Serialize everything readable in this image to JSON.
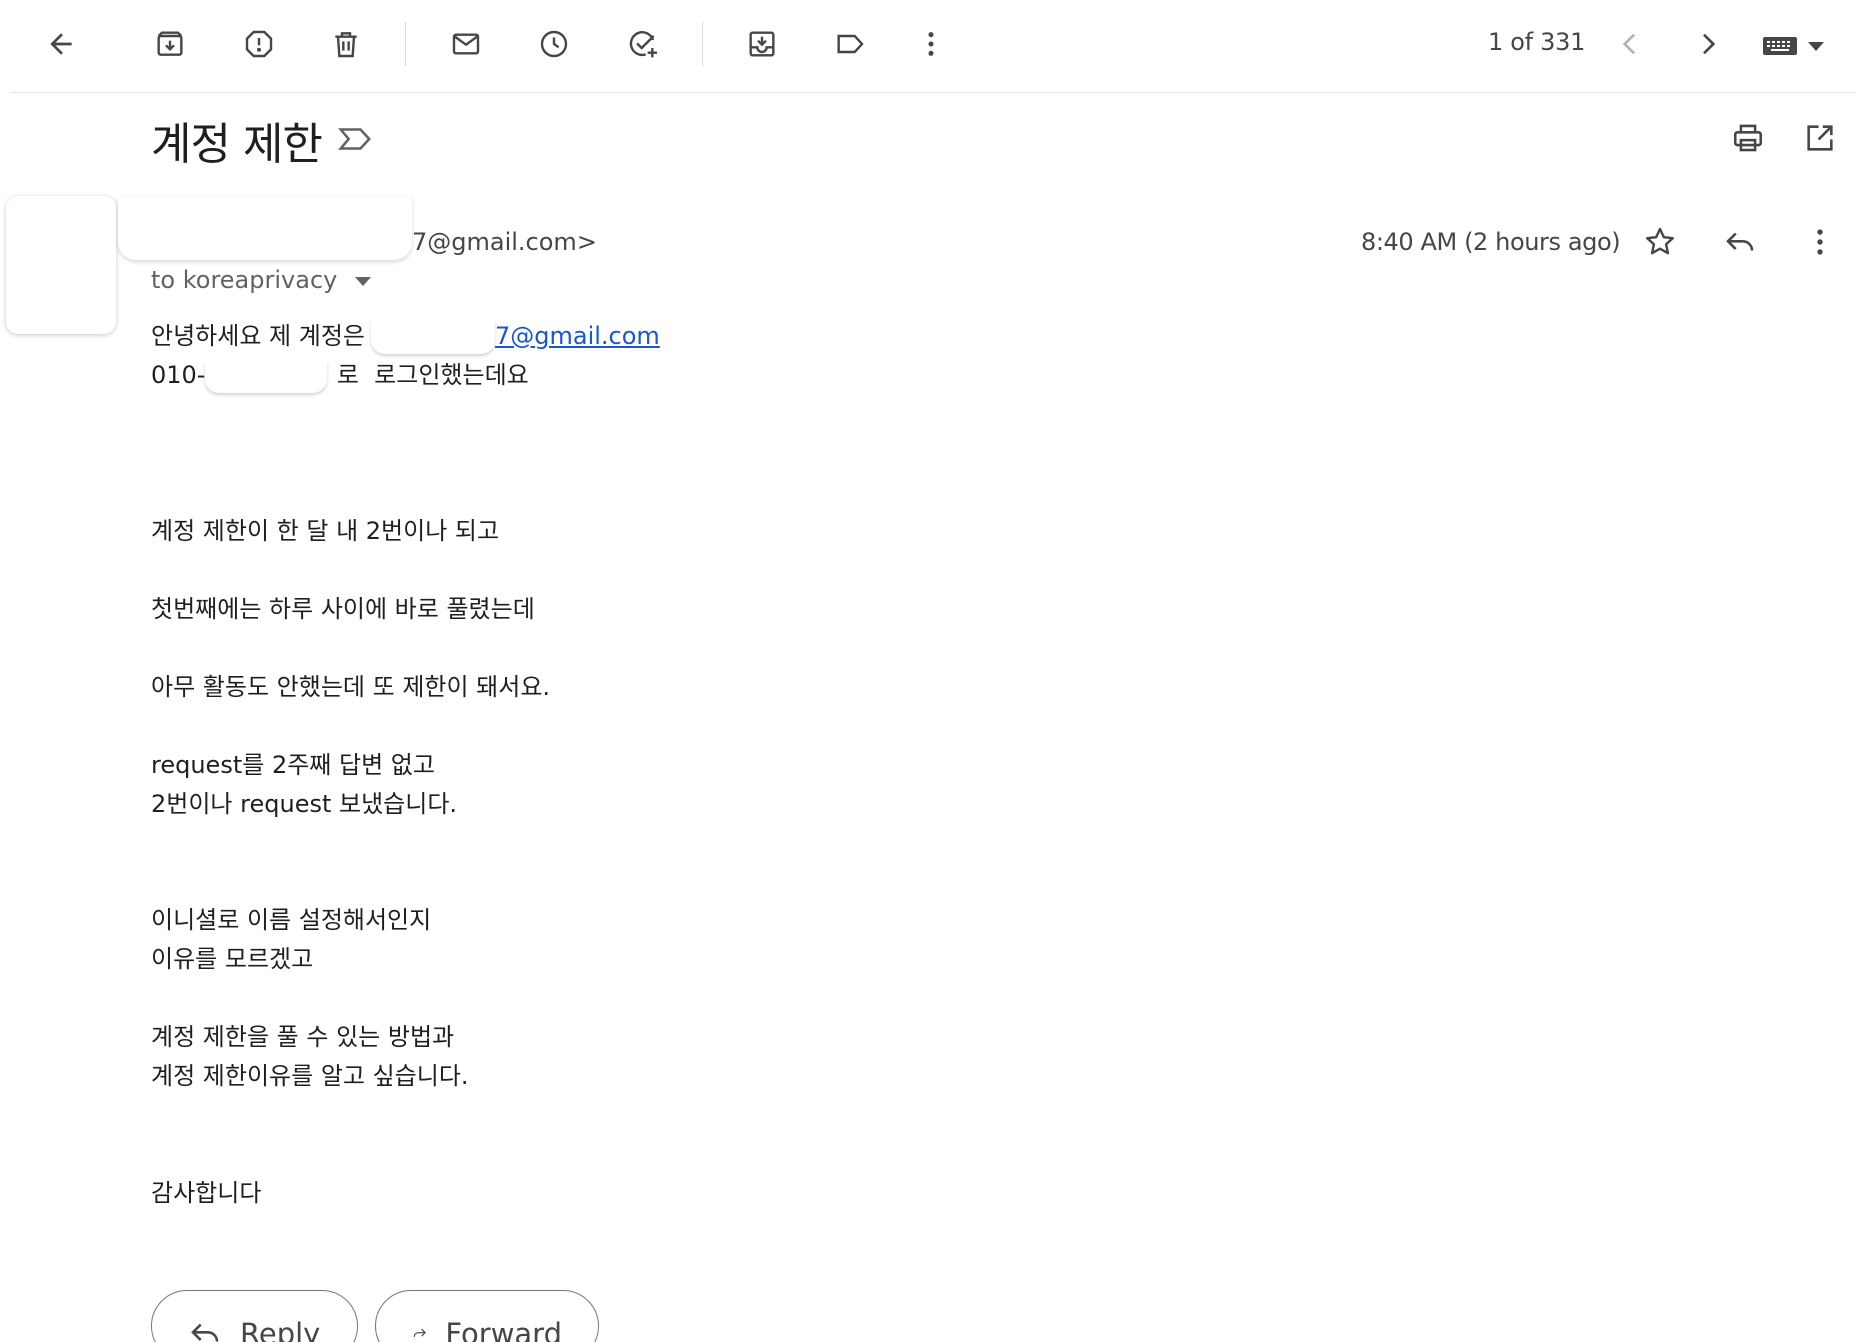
{
  "toolbar": {
    "back_icon": "arrow-back-icon",
    "archive_icon": "archive-icon",
    "report_spam_icon": "report-spam-icon",
    "delete_icon": "trash-icon",
    "mark_unread_icon": "mail-icon",
    "snooze_icon": "clock-icon",
    "add_task_icon": "add-task-icon",
    "move_to_icon": "move-to-inbox-icon",
    "labels_icon": "label-icon",
    "more_icon": "more-vert-icon",
    "pager_text": "1 of 331",
    "newer_icon": "chevron-left-icon",
    "older_icon": "chevron-right-icon",
    "input_tools_icon": "keyboard-icon"
  },
  "message": {
    "subject": "계정 제한",
    "sender_email_visible": "7@gmail.com>",
    "to_line": "to koreaprivacy",
    "timestamp": "8:40 AM (2 hours ago)",
    "body": {
      "line1_prefix": "안녕하세요 제 계정은",
      "line1_link": "7@gmail.com",
      "line2_prefix": "010-(",
      "line2_suffix": "로  로그인했는데요",
      "para1": "계정 제한이 한 달 내 2번이나 되고",
      "para2": "첫번째에는 하루 사이에 바로 풀렸는데",
      "para3": "아무 활동도 안했는데 또 제한이 돼서요.",
      "para4_line1": "request를 2주째 답변 없고",
      "para4_line2": "2번이나 request 보냈습니다.",
      "para5_line1": "이니셜로 이름 설정해서인지",
      "para5_line2": "이유를 모르겠고",
      "para6_line1": "계정 제한을 풀 수 있는 방법과",
      "para6_line2": "계정 제한이유를 알고 싶습니다.",
      "closing": "감사합니다"
    }
  },
  "actions": {
    "reply_label": "Reply",
    "forward_label": "Forward"
  },
  "colors": {
    "link": "#1a56cc",
    "icon": "#444746",
    "text": "#1f1f1f"
  }
}
